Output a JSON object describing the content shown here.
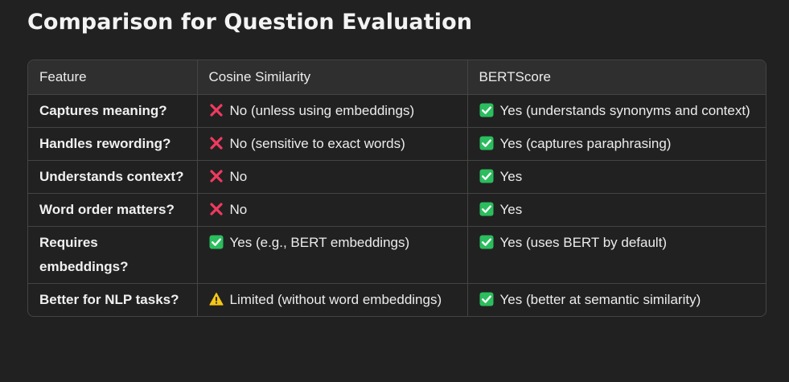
{
  "title": "Comparison for Question Evaluation",
  "columns": [
    "Feature",
    "Cosine Similarity",
    "BERTScore"
  ],
  "colors": {
    "background": "#212121",
    "header_bg": "#2f2f2f",
    "border": "#444444",
    "cross": "#f03a5f",
    "check": "#2bbd5e",
    "warning": "#f5c518"
  },
  "rows": [
    {
      "feature": "Captures meaning?",
      "cosine": {
        "icon": "cross-mark-icon",
        "text": "No (unless using embeddings)"
      },
      "bert": {
        "icon": "check-mark-icon",
        "text": "Yes (understands synonyms and context)"
      }
    },
    {
      "feature": "Handles rewording?",
      "cosine": {
        "icon": "cross-mark-icon",
        "text": "No (sensitive to exact words)"
      },
      "bert": {
        "icon": "check-mark-icon",
        "text": "Yes (captures paraphrasing)"
      }
    },
    {
      "feature": "Understands context?",
      "cosine": {
        "icon": "cross-mark-icon",
        "text": "No"
      },
      "bert": {
        "icon": "check-mark-icon",
        "text": "Yes"
      }
    },
    {
      "feature": "Word order matters?",
      "cosine": {
        "icon": "cross-mark-icon",
        "text": "No"
      },
      "bert": {
        "icon": "check-mark-icon",
        "text": "Yes"
      }
    },
    {
      "feature": "Requires embeddings?",
      "cosine": {
        "icon": "check-mark-icon",
        "text": "Yes (e.g., BERT embeddings)"
      },
      "bert": {
        "icon": "check-mark-icon",
        "text": "Yes (uses BERT by default)"
      }
    },
    {
      "feature": "Better for NLP tasks?",
      "cosine": {
        "icon": "warning-icon",
        "text": "Limited (without word embeddings)"
      },
      "bert": {
        "icon": "check-mark-icon",
        "text": "Yes (better at semantic similarity)"
      }
    }
  ]
}
